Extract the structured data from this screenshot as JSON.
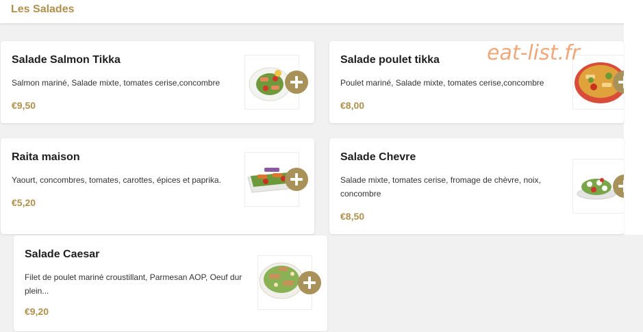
{
  "section": {
    "title": "Les Salades"
  },
  "watermark": "eat-list.fr",
  "items": [
    {
      "name": "Salade Salmon Tikka",
      "description": "Salmon mariné, Salade mixte, tomates cerise,concombre",
      "price": "€9,50",
      "image_icon": "salad-image-icon"
    },
    {
      "name": "Salade poulet tikka",
      "description": "Poulet mariné, Salade mixte, tomates cerise,concombre",
      "price": "€8,00",
      "image_icon": "salad-image-icon"
    },
    {
      "name": "Raita maison",
      "description": "Yaourt, concombres, tomates, carottes, épices et paprika.",
      "price": "€5,20",
      "image_icon": "salad-image-icon"
    },
    {
      "name": "Salade Chevre",
      "description": "Salade mixte, tomates cerise, fromage de chèvre, noix, concombre",
      "price": "€8,50",
      "image_icon": "salad-image-icon"
    },
    {
      "name": "Salade Caesar",
      "description": "Filet de poulet mariné croustillant, Parmesan AOP, Oeuf dur plein...",
      "price": "€9,20",
      "image_icon": "salad-image-icon"
    }
  ],
  "add_icon": "plus-circle-icon",
  "colors": {
    "accent": "#b08f4c",
    "button": "#a9915a",
    "background": "#f1f1f1",
    "watermark": "#f0a87a"
  }
}
